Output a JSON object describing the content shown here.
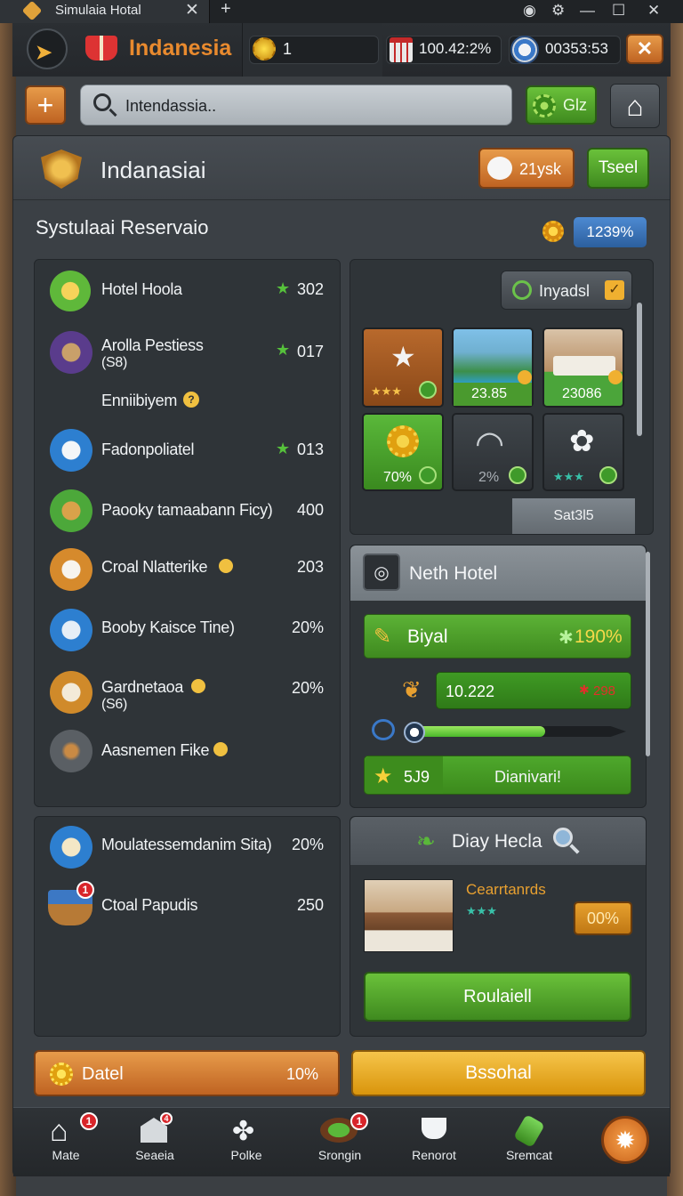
{
  "window": {
    "tab_title": "Simulaia Hotal"
  },
  "topbar": {
    "game_name": "Indanesia",
    "coins": "1",
    "calendar_value": "100.42:2%",
    "timer": "00353:53"
  },
  "search": {
    "value": "Intendassia..",
    "gift_label": "Glz"
  },
  "header": {
    "title": "Indanasiai",
    "ask_label": "21ysk",
    "tool_label": "Tseel"
  },
  "section": {
    "title": "Systulaai Reservaio",
    "rate": "1239%"
  },
  "list": [
    {
      "label": "Hotel Hoola",
      "value": "302"
    },
    {
      "label": "Arolla Pestiess",
      "sub": "(S8)",
      "value": "017"
    },
    {
      "label": "Enniibiyem",
      "value": ""
    },
    {
      "label": "Fadonpoliatel",
      "value": "013"
    },
    {
      "label": "Paooky tamaabann Ficy)",
      "value": "400"
    },
    {
      "label": "Croal Nlatterike",
      "value": "203"
    },
    {
      "label": "Booby Kaisce Tine)",
      "value": "20%"
    },
    {
      "label": "Gardnetaoa",
      "sub": "(S6)",
      "value": "20%"
    },
    {
      "label": "Aasnemen Fike",
      "value": ""
    }
  ],
  "list2": [
    {
      "label": "Moulatessemdanim Sita)",
      "value": "20%"
    },
    {
      "label": "Ctoal Papudis",
      "value": "250"
    }
  ],
  "inventory": {
    "button_label": "Inyadsl",
    "tiles": [
      {
        "value": "",
        "stars": "★★★"
      },
      {
        "value": "23.85"
      },
      {
        "value": "23086"
      },
      {
        "value": "70%"
      },
      {
        "value": "2%"
      },
      {
        "value": "",
        "stars": "★★★"
      }
    ],
    "footer": "Sat3l5"
  },
  "hotel": {
    "title": "Neth Hotel",
    "bar1_label": "Biyal",
    "bar1_value": "190%",
    "bar2_label": "10.222",
    "bar2_value": "298",
    "slider_level": 0.68,
    "bottom_value": "5J9",
    "bottom_label": "Dianivari!"
  },
  "daily": {
    "title": "Diay Hecla",
    "item_name": "Cearrtanrds",
    "item_stars": "★★★",
    "item_value": "00%",
    "action": "Roulaiell"
  },
  "bottom_buttons": {
    "left_label": "Datel",
    "left_value": "10%",
    "right_label": "Bssohal"
  },
  "nav": [
    {
      "label": "Mate",
      "badge": "1"
    },
    {
      "label": "Seaeia",
      "badge": "4"
    },
    {
      "label": "Polke",
      "badge": ""
    },
    {
      "label": "Srongin",
      "badge": "1"
    },
    {
      "label": "Renorot",
      "badge": ""
    },
    {
      "label": "Sremcat",
      "badge": ""
    }
  ],
  "colors": {
    "accent_orange": "#d6812c",
    "accent_green": "#4d9a26",
    "panel": "#353a3f"
  }
}
